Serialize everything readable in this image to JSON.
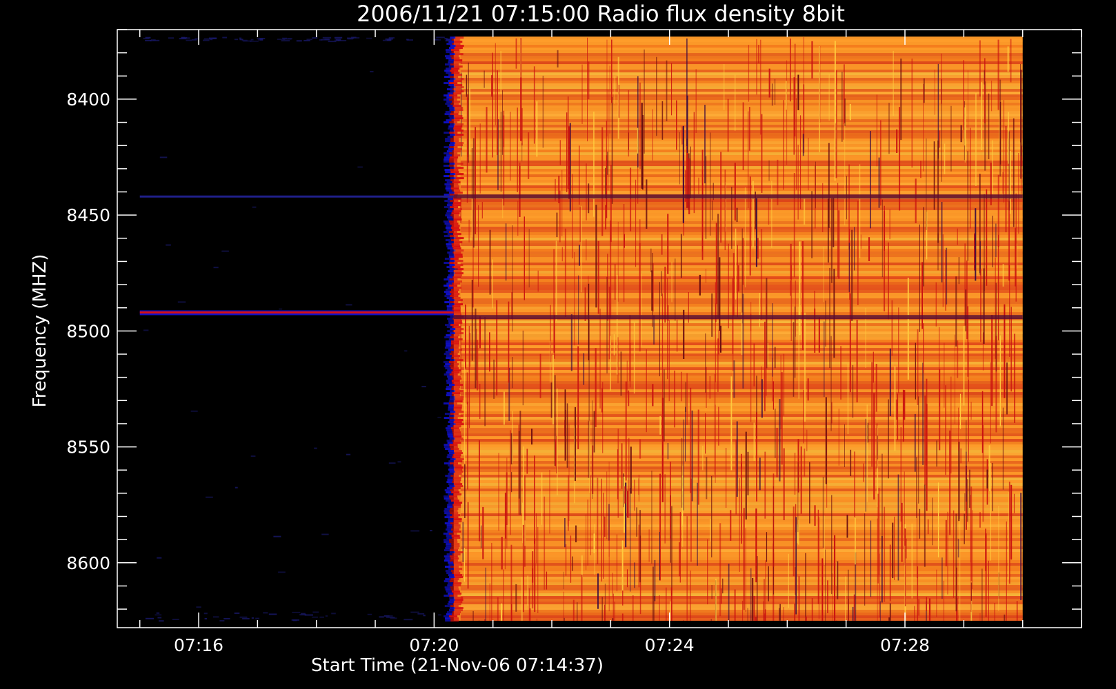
{
  "chart_data": {
    "type": "heatmap",
    "title": "2006/11/21 07:15:00 Radio flux density 8bit",
    "xlabel": "Start Time (21-Nov-06 07:14:37)",
    "ylabel": "Frequency (MHZ)",
    "xlim": [
      "07:14:37",
      "07:31:00"
    ],
    "ylim": [
      8628,
      8370
    ],
    "data_extent": {
      "x": [
        "07:15:00",
        "07:30:00"
      ],
      "y": [
        8373,
        8625
      ]
    },
    "x_ticks": [
      {
        "value": "07:16",
        "label": "07:16"
      },
      {
        "value": "07:20",
        "label": "07:20"
      },
      {
        "value": "07:24",
        "label": "07:24"
      },
      {
        "value": "07:28",
        "label": "07:28"
      }
    ],
    "y_ticks": [
      {
        "value": 8400,
        "label": "8400"
      },
      {
        "value": 8450,
        "label": "8450"
      },
      {
        "value": 8500,
        "label": "8500"
      },
      {
        "value": 8550,
        "label": "8550"
      },
      {
        "value": 8600,
        "label": "8600"
      }
    ],
    "features": {
      "burst_onset_time": "07:20:20",
      "pre_burst_lines_mhz": [
        8442,
        8492
      ],
      "post_burst_dark_lines_mhz": [
        8442,
        8494
      ]
    },
    "grid": false,
    "legend": "none",
    "colors": {
      "background": "#000000",
      "low": "#1010c8",
      "mid": "#d81010",
      "high": "#ff9a2a",
      "peak": "#ffd040",
      "axis": "#ffffff"
    }
  }
}
